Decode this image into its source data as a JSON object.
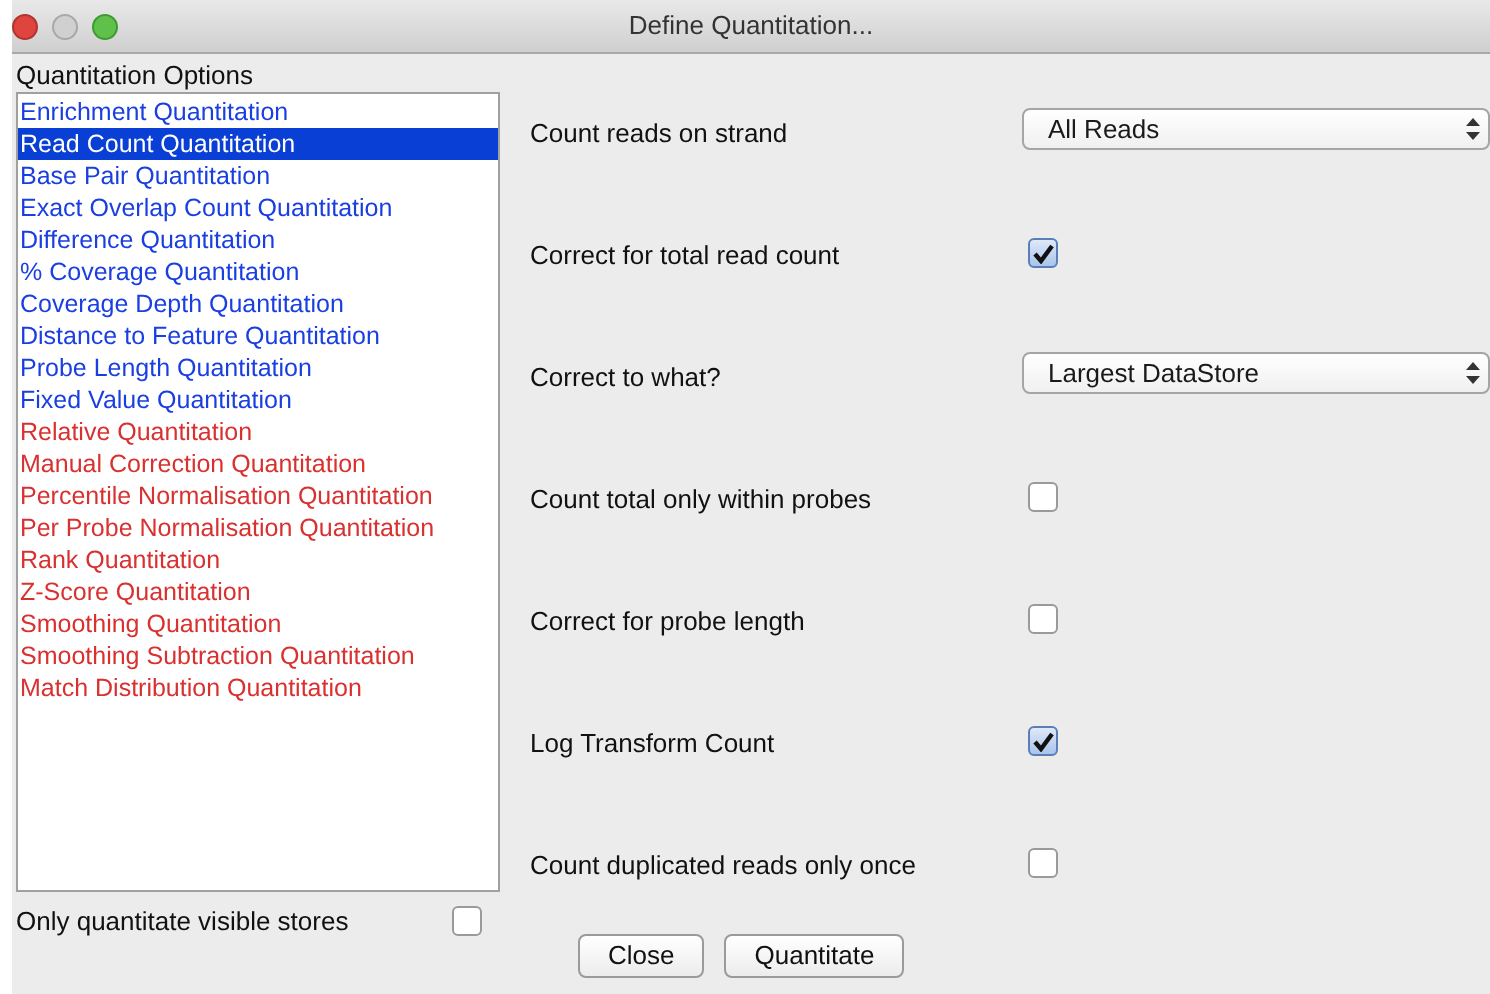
{
  "window": {
    "title": "Define Quantitation..."
  },
  "options_label": "Quantitation Options",
  "options": [
    {
      "label": "Enrichment Quantitation",
      "selected": false,
      "kind": "raw"
    },
    {
      "label": "Read Count Quantitation",
      "selected": true
    },
    {
      "label": "Base Pair Quantitation",
      "selected": false,
      "kind": "raw"
    },
    {
      "label": "Exact Overlap Count Quantitation",
      "selected": false,
      "kind": "raw"
    },
    {
      "label": "Difference Quantitation",
      "selected": false,
      "kind": "raw"
    },
    {
      "label": "% Coverage Quantitation",
      "selected": false,
      "kind": "raw"
    },
    {
      "label": "Coverage Depth Quantitation",
      "selected": false,
      "kind": "raw"
    },
    {
      "label": "Distance to Feature Quantitation",
      "selected": false,
      "kind": "raw"
    },
    {
      "label": "Probe Length Quantitation",
      "selected": false,
      "kind": "raw"
    },
    {
      "label": "Fixed Value Quantitation",
      "selected": false,
      "kind": "raw"
    },
    {
      "label": "Relative Quantitation",
      "selected": false,
      "kind": "normalisation"
    },
    {
      "label": "Manual Correction Quantitation",
      "selected": false,
      "kind": "normalisation"
    },
    {
      "label": "Percentile Normalisation Quantitation",
      "selected": false,
      "kind": "normalisation"
    },
    {
      "label": "Per Probe Normalisation Quantitation",
      "selected": false,
      "kind": "normalisation"
    },
    {
      "label": "Rank Quantitation",
      "selected": false,
      "kind": "normalisation"
    },
    {
      "label": "Z-Score Quantitation",
      "selected": false,
      "kind": "normalisation"
    },
    {
      "label": "Smoothing Quantitation",
      "selected": false,
      "kind": "normalisation"
    },
    {
      "label": "Smoothing Subtraction Quantitation",
      "selected": false,
      "kind": "normalisation"
    },
    {
      "label": "Match Distribution Quantitation",
      "selected": false,
      "kind": "normalisation"
    }
  ],
  "visible_only": {
    "label": "Only quantitate visible stores",
    "checked": false
  },
  "settings": [
    {
      "kind": "select",
      "label": "Count reads on strand",
      "value": "All Reads"
    },
    {
      "kind": "checkbox",
      "label": "Correct for total read count",
      "checked": true
    },
    {
      "kind": "select",
      "label": "Correct to what?",
      "value": "Largest DataStore"
    },
    {
      "kind": "checkbox",
      "label": "Count total only within probes",
      "checked": false
    },
    {
      "kind": "checkbox",
      "label": "Correct for probe length",
      "checked": false
    },
    {
      "kind": "checkbox",
      "label": "Log Transform Count",
      "checked": true
    },
    {
      "kind": "checkbox",
      "label": "Count duplicated reads only once",
      "checked": false
    }
  ],
  "buttons": [
    "Close",
    "Quantitate"
  ]
}
